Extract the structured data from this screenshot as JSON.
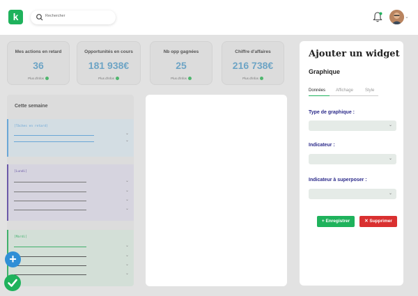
{
  "app": {
    "logo_letter": "k"
  },
  "search": {
    "placeholder": "Rechercher"
  },
  "kpis": [
    {
      "title": "Mes actions en retard",
      "value": "36",
      "more": "Plus d'infos"
    },
    {
      "title": "Opportunités en cours",
      "value": "181 938€",
      "more": "Plus d'infos"
    },
    {
      "title": "Nb opp gagnées",
      "value": "25",
      "more": "Plus d'infos"
    },
    {
      "title": "Chiffre d'affaires",
      "value": "216 738€",
      "more": "Plus d'infos"
    }
  ],
  "week": {
    "title": "Cette semaine",
    "days": [
      {
        "label": "[Tâches en retard]",
        "color": "#6aa6d6"
      },
      {
        "label": "[Lundi]",
        "color": "#6b5aa8"
      },
      {
        "label": "[Mardi]",
        "color": "#3fb06b"
      }
    ]
  },
  "panel": {
    "title": "Ajouter un widget",
    "subtitle": "Graphique",
    "tabs": [
      "Données",
      "Affichage",
      "Style"
    ],
    "fields": [
      {
        "label": "Type de graphique :"
      },
      {
        "label": "Indicateur :"
      },
      {
        "label": "Indicateur à superposer :"
      }
    ],
    "save_label": "Enregistrer",
    "delete_label": "Supprimer"
  },
  "colors": {
    "brand": "#1fb25c",
    "danger": "#d93030",
    "accent": "#2f8fd6",
    "kpi_value": "#6da4c5",
    "label": "#2b2a8a"
  }
}
